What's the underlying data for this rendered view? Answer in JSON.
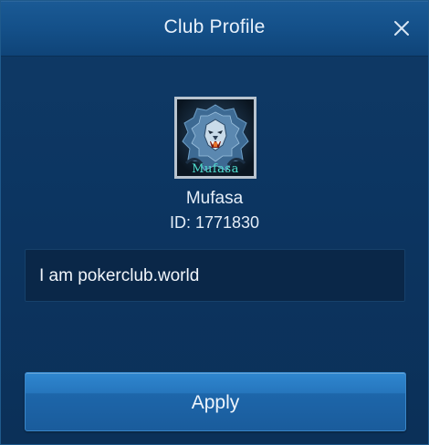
{
  "dialog": {
    "title": "Club Profile",
    "close_icon": "close-icon"
  },
  "club": {
    "avatar_icon": "lion-emblem",
    "avatar_caption": "Mufasa",
    "name": "Mufasa",
    "id_text": "ID: 1771830",
    "description": "I am pokerclub.world"
  },
  "actions": {
    "apply_label": "Apply"
  },
  "colors": {
    "background": "#0c3561",
    "header": "#145089",
    "button": "#2676bd",
    "text": "#e8f1fb"
  }
}
